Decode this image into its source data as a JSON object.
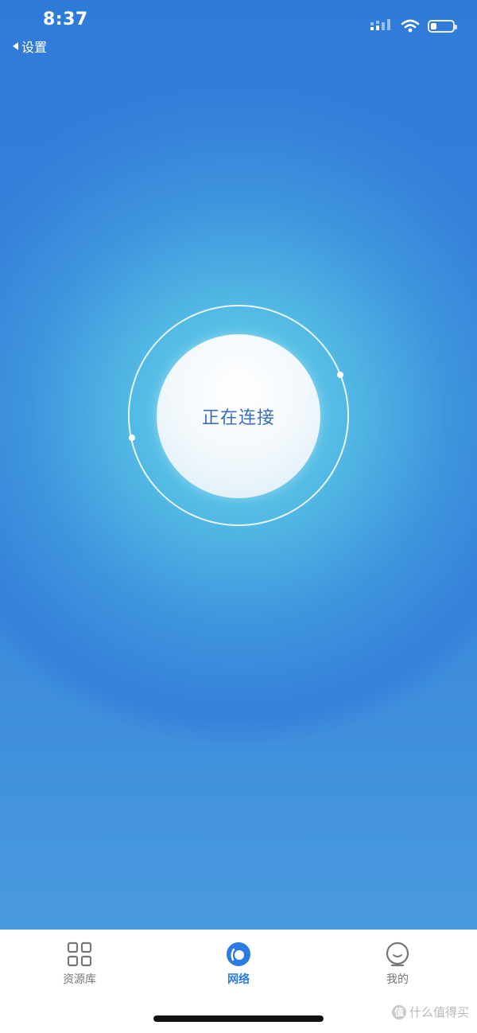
{
  "status_bar": {
    "time": "8:37",
    "back_label": "设置"
  },
  "main": {
    "connect_status": "正在连接"
  },
  "tabbar": {
    "tabs": [
      {
        "label": "资源库",
        "icon": "grid-icon",
        "active": false
      },
      {
        "label": "网络",
        "icon": "network-icon",
        "active": true
      },
      {
        "label": "我的",
        "icon": "profile-icon",
        "active": false
      }
    ]
  },
  "watermark": {
    "badge": "值",
    "text": "什么值得买"
  },
  "colors": {
    "accent": "#2c7be0",
    "background_top": "#2f7cd8",
    "glow": "#62d0ec",
    "tab_inactive": "#777777"
  }
}
